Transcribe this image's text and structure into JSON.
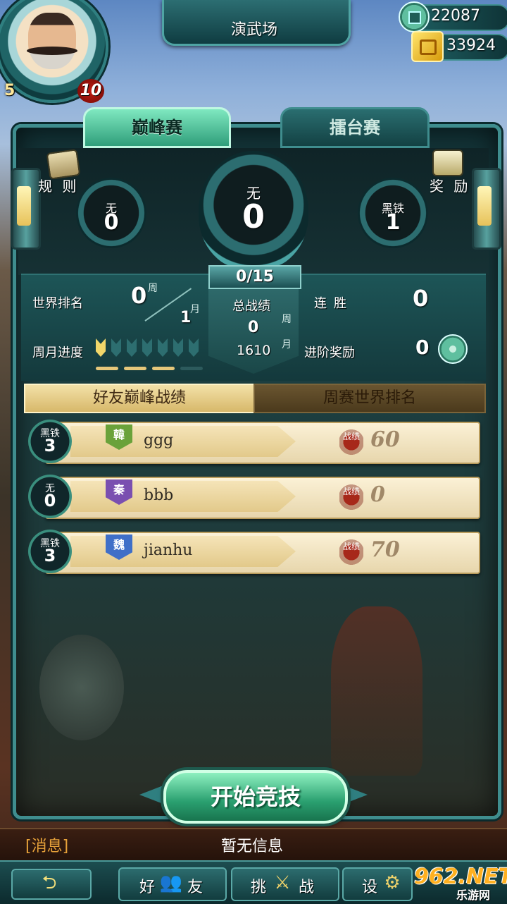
{
  "header": {
    "title": "演武场",
    "player_level": "5",
    "vip_level": "10",
    "currency_coins": "22087",
    "currency_gold": "33924"
  },
  "mode_tabs": [
    {
      "label": "巅峰赛",
      "active": true
    },
    {
      "label": "擂台赛",
      "active": false
    }
  ],
  "side_buttons": {
    "rules_label": "规 则",
    "reward_label": "奖 励"
  },
  "ranks": {
    "left": {
      "name": "无",
      "value": "0"
    },
    "center": {
      "name": "无",
      "value": "0"
    },
    "right": {
      "name": "黑铁",
      "value": "1"
    }
  },
  "progress": "0/15",
  "stats": {
    "world_rank_label": "世界排名",
    "world_rank_week": "0",
    "week_tag": "周",
    "world_rank_month": "1",
    "month_tag": "月",
    "total_record_label": "总战绩",
    "total_record_week": "0",
    "total_record_month": "1610",
    "streak_label": "连胜",
    "streak_value": "0",
    "monthly_progress_label": "周月进度",
    "monthly_progress": {
      "filled": 1,
      "total": 7
    },
    "monthly_bars": {
      "filled": 3,
      "total": 4
    },
    "advance_reward_label": "进阶奖励",
    "advance_reward_value": "0"
  },
  "list_tabs": [
    {
      "label": "好友巅峰战绩",
      "active": true
    },
    {
      "label": "周赛世界排名",
      "active": false
    }
  ],
  "friends": [
    {
      "rank_name": "黑铁",
      "rank_value": "3",
      "flag": "韓",
      "flag_color": "#6aa23a",
      "name": "ggg",
      "stamp": "战绩",
      "record": "60"
    },
    {
      "rank_name": "无",
      "rank_value": "0",
      "flag": "秦",
      "flag_color": "#7a4fb0",
      "name": "bbb",
      "stamp": "战绩",
      "record": "0"
    },
    {
      "rank_name": "黑铁",
      "rank_value": "3",
      "flag": "魏",
      "flag_color": "#3f6fc8",
      "name": "jianhu",
      "stamp": "战绩",
      "record": "70"
    }
  ],
  "start_button": "开始竞技",
  "message": {
    "label": "[消息]",
    "text": "暂无信息"
  },
  "bottom_nav": {
    "back_icon": "back-arrow-icon",
    "friends_left": "好",
    "friends_right": "友",
    "challenge_left": "挑",
    "challenge_right": "战",
    "settings_left": "设"
  },
  "watermark": {
    "main": "962.NET",
    "sub": "乐游网"
  }
}
